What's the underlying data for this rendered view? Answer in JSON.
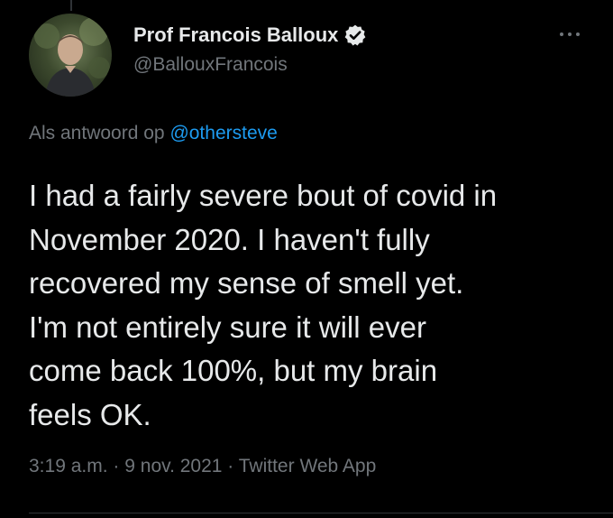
{
  "author": {
    "display_name": "Prof Francois Balloux",
    "handle": "@BallouxFrancois",
    "verified": true,
    "avatar_icon": "profile-photo"
  },
  "reply": {
    "prefix": "Als antwoord op",
    "mention": "@othersteve"
  },
  "tweet": {
    "lines": [
      "I had a fairly severe bout of covid in",
      "November 2020. I haven't fully",
      "recovered my sense of smell yet.",
      "I'm not entirely sure it will ever",
      "come back 100%, but my brain",
      "feels OK."
    ]
  },
  "meta": {
    "time": "3:19 a.m.",
    "separator": "·",
    "date": "9 nov. 2021",
    "source": "Twitter Web App"
  },
  "colors": {
    "background": "#000000",
    "text": "#e7e9ea",
    "secondary": "#71767b",
    "accent": "#1d9bf0"
  },
  "icons": {
    "verified": "verified-badge-icon",
    "more": "more-options-icon"
  }
}
